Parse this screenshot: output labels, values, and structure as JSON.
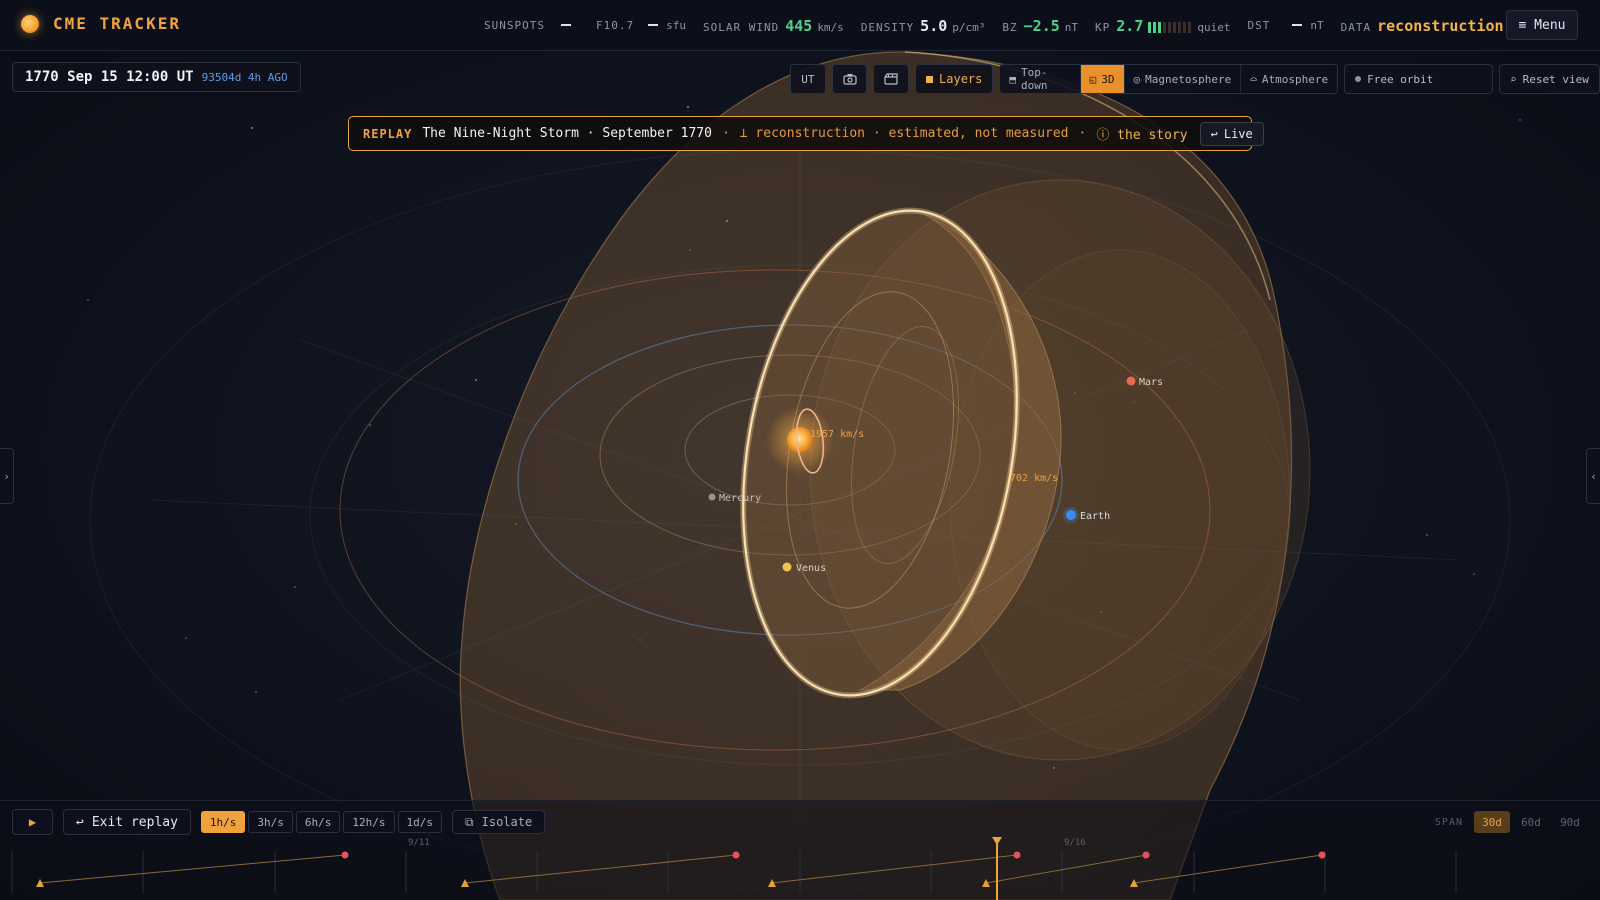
{
  "app": {
    "title": "CME TRACKER"
  },
  "metrics": {
    "sunspots": {
      "label": "SUNSPOTS"
    },
    "f107": {
      "label": "F10.7",
      "unit": "sfu"
    },
    "solar_wind": {
      "label": "SOLAR WIND",
      "value": "445",
      "unit": "km/s"
    },
    "density": {
      "label": "DENSITY",
      "value": "5.0",
      "unit": "p/cm³"
    },
    "bz": {
      "label": "BZ",
      "value": "−2.5",
      "unit": "nT"
    },
    "kp": {
      "label": "KP",
      "value": "2.7",
      "level_bars": 3,
      "total_bars": 9,
      "status": "quiet"
    },
    "dst": {
      "label": "DST",
      "unit": "nT"
    },
    "data": {
      "label": "DATA",
      "value": "reconstruction"
    }
  },
  "menu_label": "≡ Menu",
  "date": {
    "value": "1770 Sep 15 12:00 UT",
    "ago": "93504d 4h AGO"
  },
  "toolbar": {
    "ut_label": "UT",
    "layers_label": "Layers",
    "views": [
      {
        "label": "Top-down",
        "icon": "⬒",
        "active": false
      },
      {
        "label": "3D",
        "icon": "◱",
        "active": true
      },
      {
        "label": "Magnetosphere",
        "icon": "◎",
        "active": false
      },
      {
        "label": "Atmosphere",
        "icon": "⌓",
        "active": false
      }
    ],
    "orbit_label": "Free orbit",
    "reset_label": "Reset view"
  },
  "banner": {
    "tag": "REPLAY",
    "title": "The Nine-Night Storm · September 1770",
    "recon": "⟂ reconstruction · estimated, not measured",
    "story": "ⓘ the story",
    "live_label": "Live"
  },
  "scene": {
    "planets": [
      {
        "name": "Mercury",
        "color": "#9a9288"
      },
      {
        "name": "Venus",
        "color": "#f2c24e"
      },
      {
        "name": "Earth",
        "color": "#3b8cf0"
      },
      {
        "name": "Mars",
        "color": "#e8684a"
      }
    ],
    "cme_speed_inner": "1957 km/s",
    "cme_speed_outer": "702 km/s"
  },
  "controls": {
    "play_label": "▶",
    "exit_label": "Exit replay",
    "speeds": [
      "1h/s",
      "3h/s",
      "6h/s",
      "12h/s",
      "1d/s"
    ],
    "active_speed": "1h/s",
    "isolate_label": "Isolate"
  },
  "span": {
    "label": "SPAN",
    "options": [
      "30d",
      "60d",
      "90d"
    ],
    "active": "30d"
  },
  "timeline": {
    "date_labels": [
      "9/11",
      "9/16"
    ]
  },
  "colors": {
    "accent": "#f2a23c",
    "kp_green": "#4fd18b",
    "earth_blue": "#3b8cf0"
  }
}
